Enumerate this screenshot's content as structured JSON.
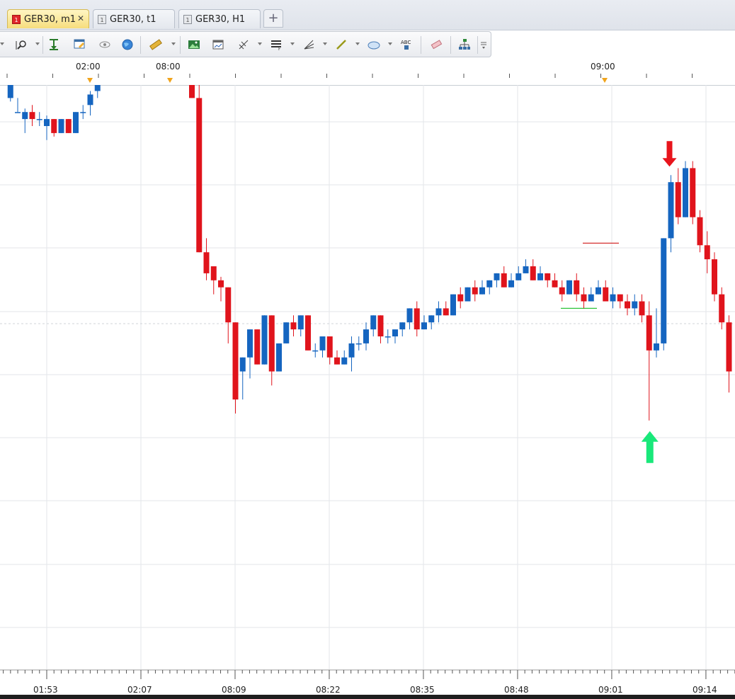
{
  "tabs": [
    {
      "label": "GER30, m1",
      "icon": "chart-tab-icon",
      "active": true,
      "closable": true
    },
    {
      "label": "GER30, t1",
      "icon": "chart-tab-icon",
      "active": false,
      "closable": false
    },
    {
      "label": "GER30, H1",
      "icon": "chart-tab-icon",
      "active": false,
      "closable": false
    }
  ],
  "add_tab_label": "+",
  "close_glyph": "✕",
  "toolbar": {
    "items": [
      "zoom-icon",
      "period-separator-icon",
      "chart-template-icon",
      "eye-icon",
      "globe-icon",
      "ruler-icon",
      "picture-icon",
      "chart-window-icon",
      "fibonacci-icon",
      "lines-icon",
      "trend-fan-icon",
      "pencil-line-icon",
      "ellipse-icon",
      "text-abc-icon",
      "eraser-icon",
      "object-tree-icon",
      "more-icon"
    ]
  },
  "top_axis": {
    "labels": [
      "02:00",
      "08:00",
      "09:00"
    ]
  },
  "bottom_axis": {
    "labels": [
      "01:53",
      "02:07",
      "08:09",
      "08:22",
      "08:35",
      "08:48",
      "09:01",
      "09:14"
    ]
  },
  "colors": {
    "bull": "#1565c0",
    "bear": "#e0141c",
    "grid": "#e3e6ea",
    "arrow_down": "#e8141c",
    "arrow_up": "#19e87a",
    "red_level": "#d01818",
    "green_level": "#2cc43a",
    "tab_active": "#f6dd7c"
  },
  "chart_data": {
    "type": "candlestick",
    "symbol": "GER30",
    "timeframe": "m1",
    "note_markers": [
      {
        "type": "sell-arrow",
        "candle_index": 86,
        "color": "red"
      },
      {
        "type": "buy-arrow",
        "candle_index": 83,
        "color": "green"
      }
    ],
    "levels": [
      {
        "color": "red",
        "value": 13.3
      },
      {
        "color": "green",
        "value": 4.0
      }
    ],
    "candles": [
      [
        -5,
        34,
        38,
        39,
        33.5
      ],
      [
        -4,
        32,
        32,
        34,
        32
      ],
      [
        -3,
        31,
        32,
        32.5,
        29
      ],
      [
        -2,
        32,
        31,
        33,
        30
      ],
      [
        -1,
        31,
        31,
        32,
        30
      ],
      [
        0,
        30,
        31,
        31.5,
        28
      ],
      [
        1,
        31,
        29,
        31,
        28.5
      ],
      [
        2,
        29,
        31,
        31,
        29
      ],
      [
        3,
        31,
        29,
        31,
        29
      ],
      [
        4,
        29,
        32,
        32,
        29
      ],
      [
        5,
        32,
        32,
        33,
        31
      ],
      [
        6,
        33,
        34.5,
        35,
        31.5
      ],
      [
        7,
        35,
        37,
        37.5,
        34
      ],
      [
        8,
        37,
        38.5,
        38.5,
        37
      ],
      [
        9,
        38.5,
        41,
        42,
        38
      ],
      [
        10,
        41,
        44,
        44.5,
        40
      ],
      [
        11,
        43,
        42,
        44.5,
        41
      ],
      [
        12,
        42,
        41,
        43,
        40
      ],
      [
        13,
        41,
        41,
        42,
        40
      ],
      [
        14,
        42,
        41,
        42,
        39
      ],
      [
        15,
        41,
        42,
        42,
        40
      ],
      [
        16,
        42,
        40,
        42,
        39
      ],
      [
        17,
        40,
        38,
        40,
        38
      ],
      [
        18,
        39,
        38,
        39,
        36
      ],
      [
        19,
        38,
        37,
        39,
        36
      ],
      [
        20,
        37,
        34,
        37,
        34
      ],
      [
        21,
        34,
        12,
        37,
        12
      ],
      [
        22,
        12,
        9,
        14,
        8
      ],
      [
        23,
        10,
        8,
        10,
        6
      ],
      [
        24,
        8,
        7,
        8.5,
        5
      ],
      [
        25,
        7,
        2,
        7,
        -1
      ],
      [
        26,
        2,
        -9,
        2,
        -11
      ],
      [
        27,
        -5,
        -3,
        -3,
        -9
      ],
      [
        28,
        -3,
        1,
        1,
        -6
      ],
      [
        29,
        1,
        -4,
        1,
        -4
      ],
      [
        30,
        -4,
        3,
        3,
        -4
      ],
      [
        31,
        3,
        -5,
        3,
        -7
      ],
      [
        32,
        -5,
        -1,
        -1,
        -5
      ],
      [
        33,
        -1,
        2,
        2,
        -1
      ],
      [
        34,
        2,
        1,
        3,
        0
      ],
      [
        35,
        1,
        3,
        3,
        0
      ],
      [
        36,
        3,
        -2,
        3,
        -2
      ],
      [
        37,
        -2,
        -2,
        -1,
        -3
      ],
      [
        38,
        -2,
        0,
        0,
        -3
      ],
      [
        39,
        0,
        -3,
        0,
        -4
      ],
      [
        40,
        -3,
        -4,
        -2,
        -4
      ],
      [
        41,
        -4,
        -3,
        -2,
        -4
      ],
      [
        42,
        -3,
        -1,
        0,
        -5
      ],
      [
        43,
        -1,
        -1,
        0,
        -2
      ],
      [
        44,
        -1,
        1,
        2,
        -2
      ],
      [
        45,
        1,
        3,
        3,
        0
      ],
      [
        46,
        3,
        0,
        3,
        -1
      ],
      [
        47,
        0,
        0,
        1,
        -1
      ],
      [
        48,
        0,
        1,
        1,
        -1
      ],
      [
        49,
        1,
        2,
        2,
        0
      ],
      [
        50,
        2,
        4,
        4,
        1
      ],
      [
        51,
        4,
        1,
        5,
        0
      ],
      [
        52,
        1,
        2,
        3,
        1
      ],
      [
        53,
        2,
        3,
        3,
        1
      ],
      [
        54,
        3,
        4,
        5,
        2
      ],
      [
        55,
        4,
        3,
        5,
        3
      ],
      [
        56,
        3,
        6,
        6,
        3
      ],
      [
        57,
        6,
        5,
        7,
        4
      ],
      [
        58,
        5,
        7,
        7,
        5
      ],
      [
        59,
        7,
        6,
        8,
        5
      ],
      [
        60,
        6,
        7,
        8,
        6
      ],
      [
        61,
        7,
        8,
        8,
        6
      ],
      [
        62,
        8,
        9,
        9,
        7
      ],
      [
        63,
        9,
        7,
        10,
        7
      ],
      [
        64,
        7,
        8,
        9,
        7
      ],
      [
        65,
        8,
        9,
        10,
        8
      ],
      [
        66,
        9,
        10,
        11,
        9
      ],
      [
        67,
        10,
        8,
        11,
        8
      ],
      [
        68,
        8,
        9,
        10,
        8
      ],
      [
        69,
        9,
        8,
        9,
        7
      ],
      [
        70,
        8,
        7,
        9,
        7
      ],
      [
        71,
        7,
        6,
        8,
        5
      ],
      [
        72,
        6,
        8,
        8,
        6
      ],
      [
        73,
        8,
        6,
        9,
        5
      ],
      [
        74,
        6,
        5,
        7,
        4
      ],
      [
        75,
        5,
        6,
        7,
        5
      ],
      [
        76,
        6,
        7,
        8,
        6
      ],
      [
        77,
        7,
        5,
        8,
        5
      ],
      [
        78,
        5,
        6,
        7,
        4
      ],
      [
        79,
        6,
        5,
        6,
        4
      ],
      [
        80,
        5,
        4,
        6,
        3
      ],
      [
        81,
        4,
        5,
        6,
        3
      ],
      [
        82,
        5,
        3,
        6,
        2
      ],
      [
        83,
        3,
        -2,
        5,
        -12
      ],
      [
        84,
        -2,
        -1,
        4,
        -3
      ],
      [
        85,
        -1,
        14,
        14,
        -2
      ],
      [
        86,
        14,
        22,
        23,
        12
      ],
      [
        87,
        22,
        17,
        24,
        16
      ],
      [
        88,
        17,
        24,
        25,
        17
      ],
      [
        89,
        24,
        17,
        25,
        16
      ],
      [
        90,
        17,
        13,
        18,
        12
      ],
      [
        91,
        13,
        11,
        15,
        9
      ],
      [
        92,
        11,
        6,
        12,
        5
      ],
      [
        93,
        6,
        2,
        7,
        1
      ],
      [
        94,
        2,
        -5,
        3,
        -8
      ]
    ]
  }
}
